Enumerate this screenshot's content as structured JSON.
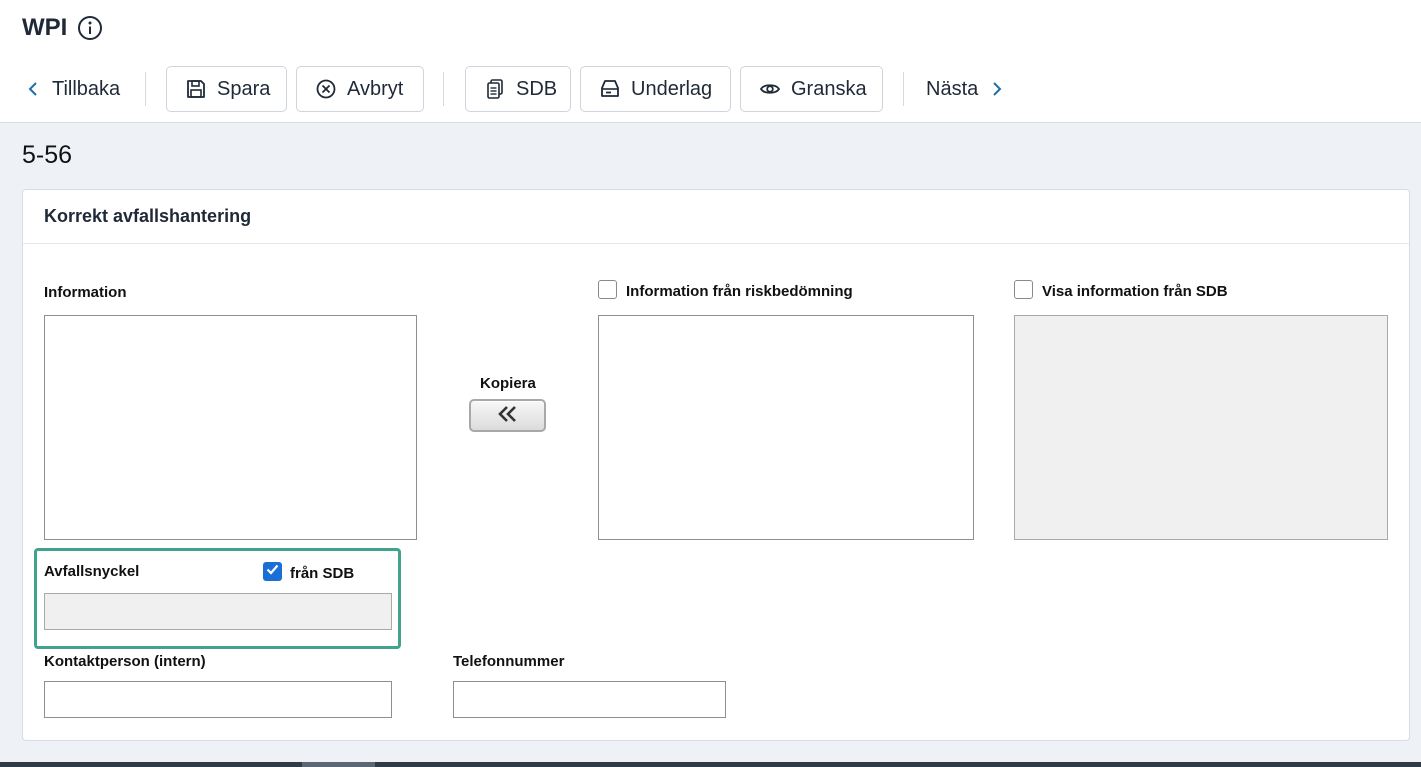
{
  "header": {
    "app_title": "WPI",
    "info_icon": "info-circle-icon"
  },
  "toolbar": {
    "back_label": "Tillbaka",
    "save_label": "Spara",
    "cancel_label": "Avbryt",
    "sdb_label": "SDB",
    "underlag_label": "Underlag",
    "review_label": "Granska",
    "next_label": "Nästa"
  },
  "page": {
    "heading": "5-56"
  },
  "card": {
    "title": "Korrekt avfallshantering",
    "information_label": "Information",
    "copy_label": "Kopiera",
    "copy_button_glyph": "«",
    "risk_info_label": "Information från riskbedömning",
    "risk_info_checked": false,
    "sdb_info_label": "Visa information från SDB",
    "sdb_info_checked": false,
    "waste_key_label": "Avfallsnyckel",
    "from_sdb_label": "från SDB",
    "from_sdb_checked": true,
    "waste_key_value": "",
    "contact_label": "Kontaktperson (intern)",
    "contact_value": "",
    "phone_label": "Telefonnummer",
    "phone_value": ""
  },
  "colors": {
    "highlight_border": "#3fa38d",
    "checkbox_checked": "#1a6fd6",
    "page_background": "#eef2f6"
  }
}
